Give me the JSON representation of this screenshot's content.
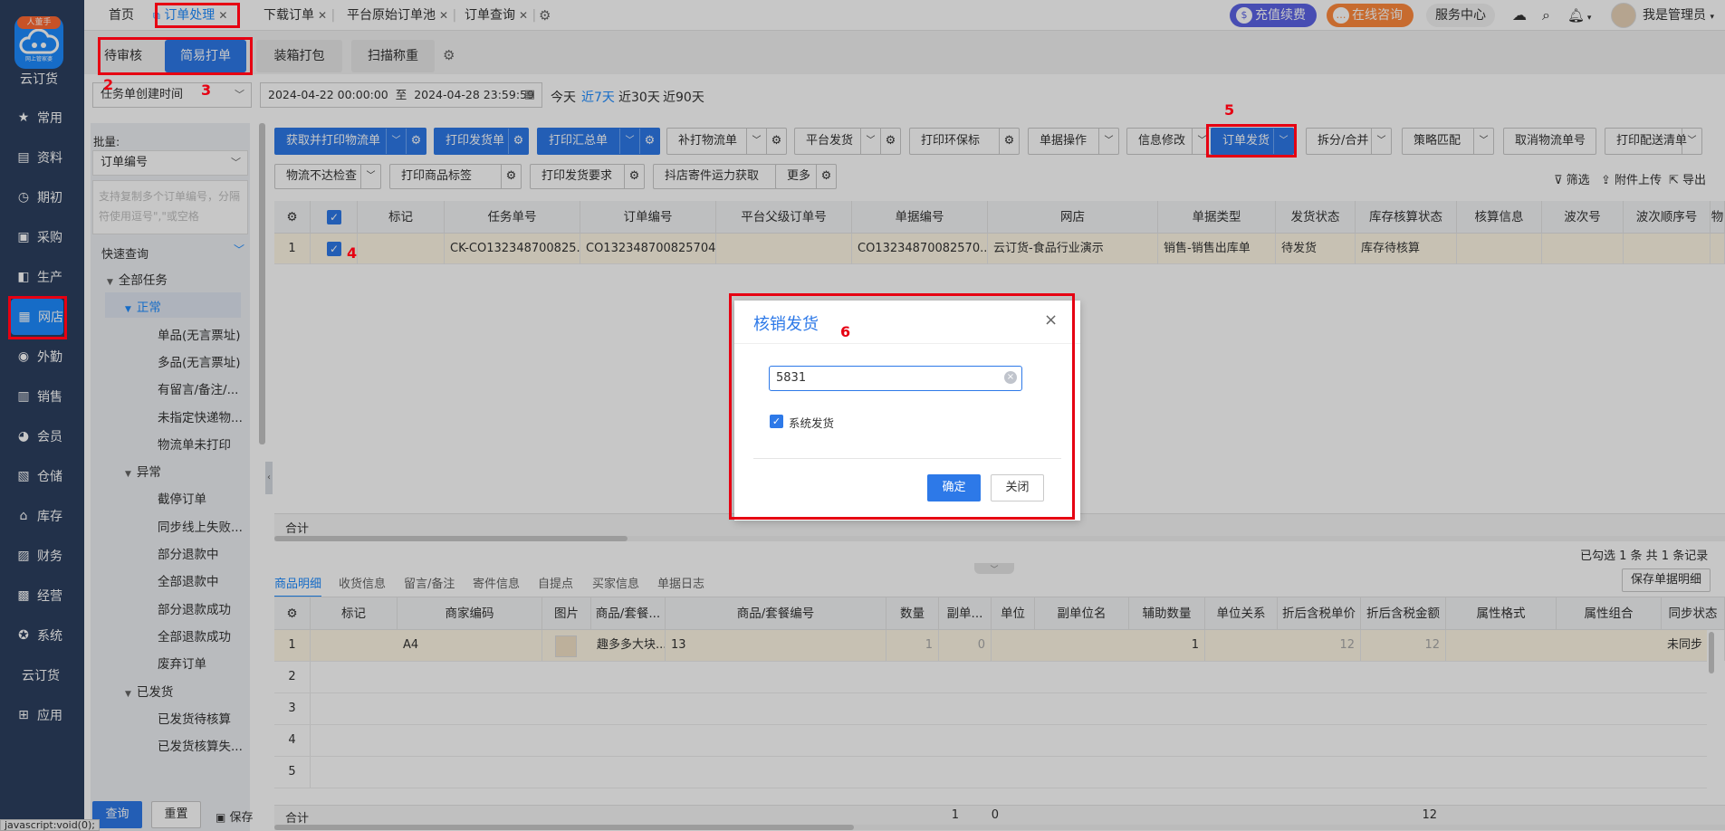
{
  "app": {
    "logo_badge": "人董手",
    "logo_sub": "网上管家婆",
    "name": "云订货"
  },
  "nav": [
    {
      "label": "常用",
      "icon": "star-icon",
      "glyph": "★"
    },
    {
      "label": "资料",
      "icon": "document-icon",
      "glyph": "▤"
    },
    {
      "label": "期初",
      "icon": "clock-icon",
      "glyph": "◷"
    },
    {
      "label": "采购",
      "icon": "cart-icon",
      "glyph": "▣"
    },
    {
      "label": "生产",
      "icon": "factory-icon",
      "glyph": "◧"
    },
    {
      "label": "网店",
      "icon": "store-icon",
      "glyph": "▦"
    },
    {
      "label": "外勤",
      "icon": "location-icon",
      "glyph": "◉"
    },
    {
      "label": "销售",
      "icon": "chart-icon",
      "glyph": "▥"
    },
    {
      "label": "会员",
      "icon": "pie-icon",
      "glyph": "◕"
    },
    {
      "label": "仓储",
      "icon": "warehouse-icon",
      "glyph": "▧"
    },
    {
      "label": "库存",
      "icon": "home-icon",
      "glyph": "⌂"
    },
    {
      "label": "财务",
      "icon": "finance-icon",
      "glyph": "▨"
    },
    {
      "label": "经营",
      "icon": "trend-icon",
      "glyph": "▩"
    },
    {
      "label": "系统",
      "icon": "gear-icon",
      "glyph": "✪"
    },
    {
      "label": "云订货",
      "icon": "",
      "glyph": ""
    },
    {
      "label": "应用",
      "icon": "plus-icon",
      "glyph": "⊞"
    }
  ],
  "tabs": [
    {
      "label": "首页"
    },
    {
      "label": "订单处理"
    },
    {
      "label": "下载订单"
    },
    {
      "label": "平台原始订单池"
    },
    {
      "label": "订单查询"
    }
  ],
  "header": {
    "recharge": "充值续费",
    "consult": "在线咨询",
    "service": "服务中心",
    "user": "我是管理员"
  },
  "subtabs": {
    "pending": "待审核",
    "simple_print": "简易打单",
    "packing": "装箱打包",
    "scan_weigh": "扫描称重"
  },
  "filter": {
    "time_field": "任务单创建时间",
    "start": "2024-04-22 00:00:00",
    "to": "至",
    "end": "2024-04-28 23:59:59",
    "today": "今天",
    "last7": "近7天",
    "last30": "近30天",
    "last90": "近90天"
  },
  "left": {
    "batch_label": "批量:",
    "field": "订单编号",
    "placeholder_line1": "支持复制多个订单编号，分隔",
    "placeholder_line2": "符使用逗号\",\"或空格",
    "quick_query": "快速查询",
    "tree": [
      {
        "label": "全部任务",
        "level": 0,
        "caret": true
      },
      {
        "label": "正常",
        "level": 1,
        "caret": true,
        "selected": true
      },
      {
        "label": "单品(无言票址)",
        "level": 2
      },
      {
        "label": "多品(无言票址)",
        "level": 2
      },
      {
        "label": "有留言/备注/...",
        "level": 2
      },
      {
        "label": "未指定快递物...",
        "level": 2
      },
      {
        "label": "物流单未打印",
        "level": 2
      },
      {
        "label": "异常",
        "level": 1,
        "caret": true
      },
      {
        "label": "截停订单",
        "level": 2
      },
      {
        "label": "同步线上失败...",
        "level": 2
      },
      {
        "label": "部分退款中",
        "level": 2
      },
      {
        "label": "全部退款中",
        "level": 2
      },
      {
        "label": "部分退款成功",
        "level": 2
      },
      {
        "label": "全部退款成功",
        "level": 2
      },
      {
        "label": "废弃订单",
        "level": 2
      },
      {
        "label": "已发货",
        "level": 1,
        "caret": true
      },
      {
        "label": "已发货待核算",
        "level": 2
      },
      {
        "label": "已发货核算失...",
        "level": 2
      }
    ],
    "query_btn": "查询",
    "reset_btn": "重置",
    "save_btn": "保存",
    "status_url": "javascript:void(0);"
  },
  "toolbar": {
    "row1": [
      "获取并打印物流单",
      "打印发货单",
      "打印汇总单",
      "补打物流单",
      "平台发货",
      "打印环保标",
      "单据操作",
      "信息修改",
      "订单发货",
      "拆分/合并",
      "策略匹配",
      "取消物流单号",
      "打印配送清单"
    ],
    "row2": [
      "物流不达检查",
      "打印商品标签",
      "打印发货要求",
      "抖店寄件运力获取",
      "更多"
    ],
    "filter": "筛选",
    "upload": "附件上传",
    "export": "导出"
  },
  "orders": {
    "headers": [
      "标记",
      "任务单号",
      "订单编号",
      "平台父级订单号",
      "单据编号",
      "网店",
      "单据类型",
      "发货状态",
      "库存核算状态",
      "核算信息",
      "波次号",
      "波次顺序号",
      "物"
    ],
    "rows": [
      {
        "idx": "1",
        "cells": [
          "",
          "CK-CO132348700825...",
          "CO132348700825704...",
          "",
          "CO13234870082570...",
          "云订货-食品行业演示",
          "销售-销售出库单",
          "待发货",
          "库存待核算",
          "",
          "",
          "",
          ""
        ]
      }
    ],
    "total_label": "合计",
    "summary": "已勾选 1 条 共 1 条记录"
  },
  "detail_tabs": [
    "商品明细",
    "收货信息",
    "留言/备注",
    "寄件信息",
    "自提点",
    "买家信息",
    "单据日志"
  ],
  "save_detail": "保存单据明细",
  "items": {
    "headers": [
      "标记",
      "商家编码",
      "图片",
      "商品/套餐...",
      "商品/套餐编号",
      "数量",
      "副单...",
      "单位",
      "副单位名",
      "辅助数量",
      "单位关系",
      "折后含税单价",
      "折后含税金额",
      "属性格式",
      "属性组合",
      "同步状态"
    ],
    "rows": [
      {
        "idx": "1",
        "code": "A4",
        "name": "趣多多大块...",
        "number": "13",
        "qty": "1",
        "sub": "0",
        "aux": "1",
        "price": "12",
        "amount": "12",
        "sync": "未同步"
      }
    ],
    "empty_rows": [
      "2",
      "3",
      "4",
      "5"
    ],
    "total_label": "合计",
    "total_qty": "1",
    "total_sub": "0",
    "total_amount": "12"
  },
  "modal": {
    "title": "核销发货",
    "input_value": "5831",
    "checkbox_label": "系统发货",
    "confirm": "确定",
    "close": "关闭"
  },
  "annotations": [
    "2",
    "3",
    "4",
    "5",
    "6"
  ],
  "colors": {
    "sidebar": "#2c3f5f",
    "primary": "#2d79e8",
    "annotation": "#e60012",
    "recharge": "#5b63e6",
    "consult": "#ff8a3d"
  }
}
